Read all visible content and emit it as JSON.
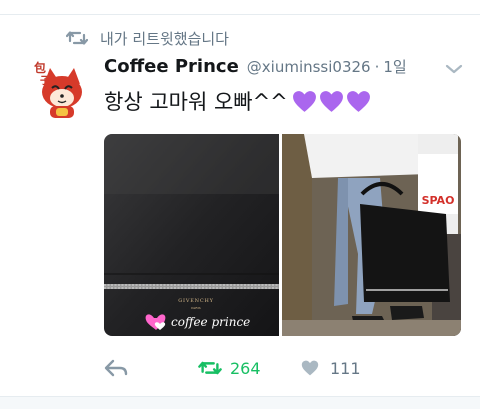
{
  "retweet_context": {
    "icon": "retweet-icon",
    "text": "내가 리트윗했습니다"
  },
  "tweet": {
    "avatar": {
      "description": "red cartoon fox avatar",
      "label_chars": "包子"
    },
    "display_name": "Coffee Prince",
    "handle": "@xiuminssi0326",
    "separator": "·",
    "time": "1일",
    "menu_icon": "chevron-down-icon",
    "text": "항상 고마워 오빠^^",
    "emoji": [
      "purple-heart",
      "purple-heart",
      "purple-heart"
    ],
    "emoji_color": "#aa66ee",
    "media": [
      {
        "name": "bag-closeup-photo",
        "brand": "GIVENCHY",
        "brand_sub": "PARIS",
        "handwriting": "coffee prince"
      },
      {
        "name": "person-carrying-bag-photo",
        "shopping_bag_text": "SPAO"
      }
    ]
  },
  "actions": {
    "reply": {
      "icon": "reply-icon"
    },
    "retweet": {
      "icon": "retweet-icon",
      "count": "264",
      "color": "#17bf63"
    },
    "like": {
      "icon": "heart-icon",
      "count": "111",
      "color": "#aab8c2"
    }
  }
}
